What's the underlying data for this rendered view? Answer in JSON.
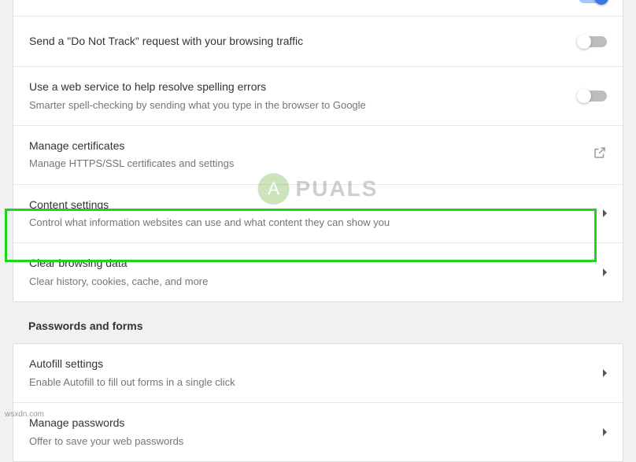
{
  "privacy_rows": [
    {
      "title": "",
      "subtitle": "",
      "control": "toggle-on"
    },
    {
      "title": "Send a \"Do Not Track\" request with your browsing traffic",
      "subtitle": "",
      "control": "toggle-off"
    },
    {
      "title": "Use a web service to help resolve spelling errors",
      "subtitle": "Smarter spell-checking by sending what you type in the browser to Google",
      "control": "toggle-off"
    },
    {
      "title": "Manage certificates",
      "subtitle": "Manage HTTPS/SSL certificates and settings",
      "control": "external"
    },
    {
      "title": "Content settings",
      "subtitle": "Control what information websites can use and what content they can show you",
      "control": "chevron"
    },
    {
      "title": "Clear browsing data",
      "subtitle": "Clear history, cookies, cache, and more",
      "control": "chevron"
    }
  ],
  "section2_header": "Passwords and forms",
  "pwd_rows": [
    {
      "title": "Autofill settings",
      "subtitle": "Enable Autofill to fill out forms in a single click",
      "control": "chevron"
    },
    {
      "title": "Manage passwords",
      "subtitle": "Offer to save your web passwords",
      "control": "chevron"
    }
  ],
  "watermark": "PUALS",
  "attribution": "wsxdn.com"
}
